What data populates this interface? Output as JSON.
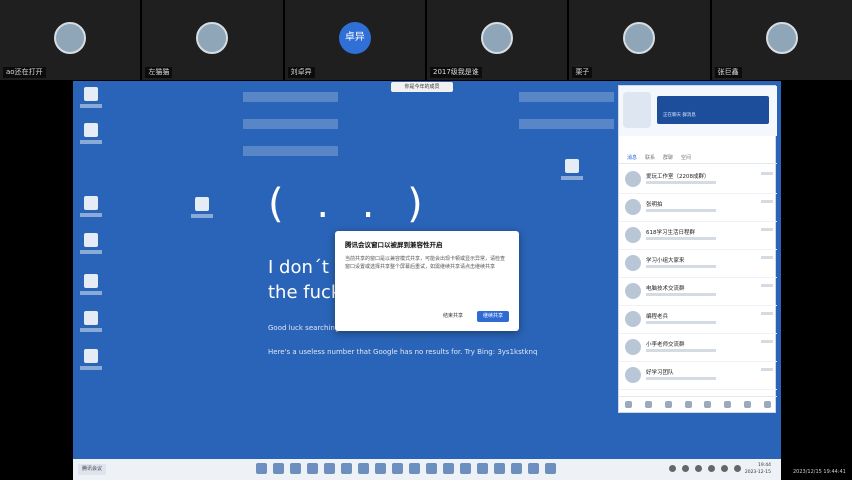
{
  "participants": [
    {
      "name": "ao还在打开"
    },
    {
      "name": "左猫猫"
    },
    {
      "name": "刘卓异",
      "initials": "卓异"
    },
    {
      "name": "2017级我是谁"
    },
    {
      "name": "栗子"
    },
    {
      "name": "张巨鑫"
    }
  ],
  "shared_screen": {
    "top_pill": "你是今年的成员",
    "sad_face": "( . . )",
    "error_line1": "I don´t k",
    "error_line2": "the fuck",
    "sub_line1": "Good luck searching",
    "sub_line2": "Here's a useless number that Google has no results for. Try Bing: 3ys1kstknq"
  },
  "dialog": {
    "title": "腾讯会议窗口以被屏到兼容性开启",
    "body": "当前共享的窗口是以兼容模式共享，可能会出现卡顿或显示异常，请检查窗口设置或选择共享整个屏幕后重试，如需继续共享请点击继续共享",
    "cancel_label": "结束共享",
    "confirm_label": "继续共享"
  },
  "qq": {
    "inner_label": "正在聊天  群消息",
    "tabs": [
      "消息",
      "联系",
      "群聊",
      "空间"
    ],
    "chats": [
      {
        "name": "爱玩工作室（2208成群）"
      },
      {
        "name": "张明拍"
      },
      {
        "name": "618学习生活日程群"
      },
      {
        "name": "学习小组大家来"
      },
      {
        "name": "电脑技术交流群"
      },
      {
        "name": "编程老兵"
      },
      {
        "name": "小李老师交流群"
      },
      {
        "name": "好学习团队"
      }
    ]
  },
  "taskbar": {
    "active_app": "腾讯会议",
    "time": "19:44",
    "date": "2023-12-15"
  },
  "recording_stamp": "2023/12/15 19:44:41"
}
